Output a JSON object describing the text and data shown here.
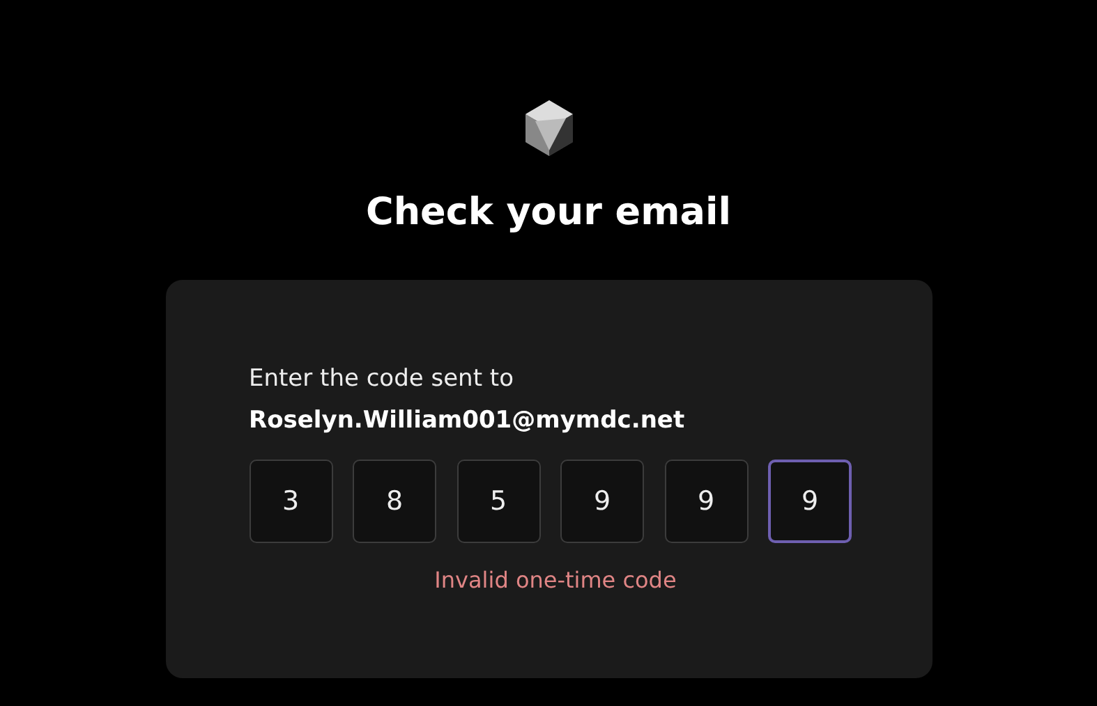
{
  "title": "Check your email",
  "prompt": "Enter the code sent to",
  "email": "Roselyn.William001@mymdc.net",
  "code_digits": [
    {
      "value": "3",
      "focused": false
    },
    {
      "value": "8",
      "focused": false
    },
    {
      "value": "5",
      "focused": false
    },
    {
      "value": "9",
      "focused": false
    },
    {
      "value": "9",
      "focused": false
    },
    {
      "value": "9",
      "focused": true
    }
  ],
  "error": "Invalid one-time code"
}
